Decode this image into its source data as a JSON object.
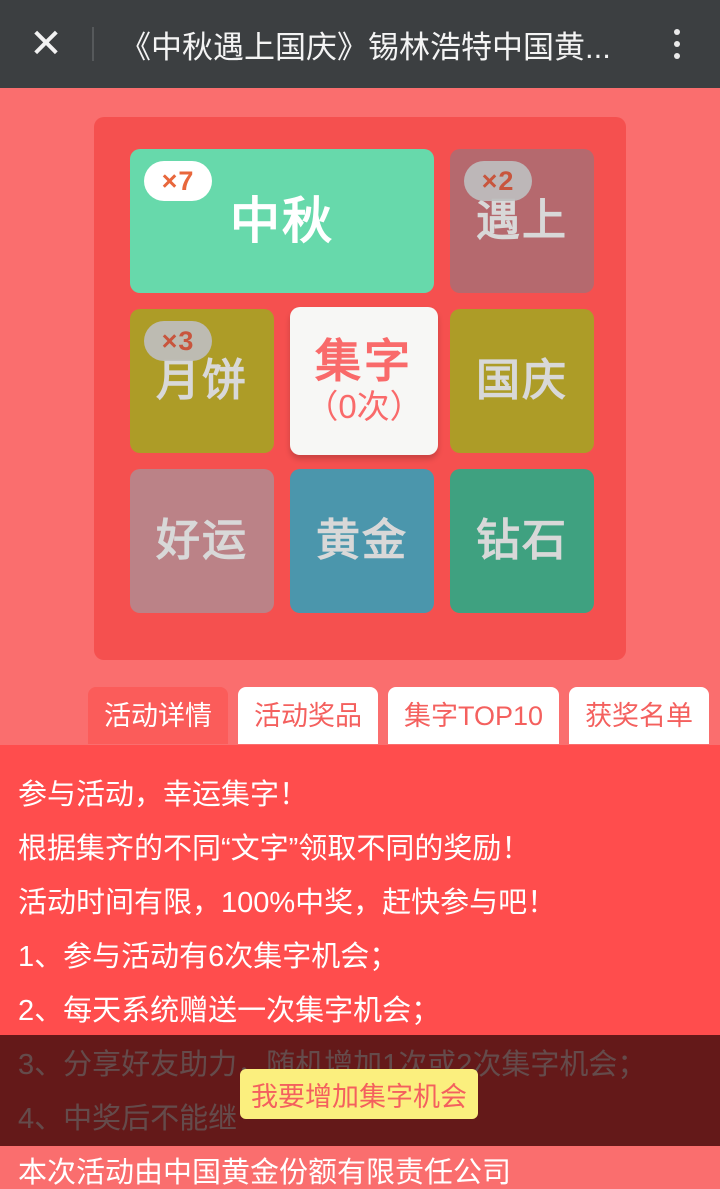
{
  "titlebar": {
    "close_label": "✕",
    "title": "《中秋遇上国庆》锡林浩特中国黄...",
    "menu_label": "more-options"
  },
  "grid": {
    "tiles": [
      {
        "key": "zhongqiu",
        "label": "中秋",
        "badge": "×7",
        "collected": true,
        "color": "#67d9ab"
      },
      {
        "key": "yushang",
        "label": "遇上",
        "badge": "×2",
        "collected": false,
        "color": "#b5696e"
      },
      {
        "key": "yuebing",
        "label": "月饼",
        "badge": "×3",
        "collected": false,
        "color": "#ad9c27"
      },
      {
        "key": "guoqing",
        "label": "国庆",
        "badge": "",
        "collected": false,
        "color": "#ad9c27"
      },
      {
        "key": "haoyun",
        "label": "好运",
        "badge": "",
        "collected": false,
        "color": "#bb8287"
      },
      {
        "key": "huangjin",
        "label": "黄金",
        "badge": "",
        "collected": false,
        "color": "#4b96ac"
      },
      {
        "key": "zuanshi",
        "label": "钻石",
        "badge": "",
        "collected": false,
        "color": "#3fa180"
      }
    ],
    "center": {
      "main": "集字",
      "sub": "（0次）",
      "remaining_count": 0
    }
  },
  "tabs": [
    {
      "label": "活动详情",
      "active": true
    },
    {
      "label": "活动奖品",
      "active": false
    },
    {
      "label": "集字TOP10",
      "active": false
    },
    {
      "label": "获奖名单",
      "active": false
    }
  ],
  "content": {
    "lines": [
      "参与活动，幸运集字！",
      "根据集齐的不同“文字”领取不同的奖励！",
      "活动时间有限，100%中奖，赶快参与吧！",
      "1、参与活动有6次集字机会；",
      "2、每天系统赠送一次集字机会；",
      "3、分享好友助力，随机增加1次或2次集字机会；",
      "4、中奖后不能继",
      "本次活动由中国黄金份额有限责任公司"
    ]
  },
  "cta": {
    "label": "我要增加集字机会"
  },
  "colors": {
    "page_bg": "#fa6e6e",
    "panel_bg": "#f5504f",
    "content_bg": "#ff4d4d",
    "titlebar_bg": "#3c3f41",
    "tab_active_bg": "#fb5c5a",
    "tab_text": "#f4605e",
    "cta_bg": "#fbef7e",
    "overlay": "rgba(40,6,6,.72)"
  }
}
